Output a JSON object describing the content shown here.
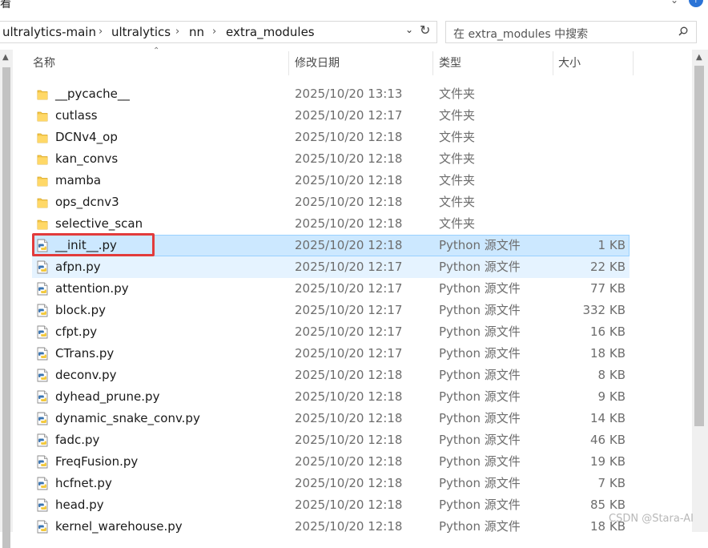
{
  "top": {
    "partial_char": "看"
  },
  "address": {
    "crumbs": [
      "ultralytics-main",
      "ultralytics",
      "nn",
      "extra_modules"
    ]
  },
  "search": {
    "placeholder": "在 extra_modules 中搜索"
  },
  "columns": {
    "name": "名称",
    "date": "修改日期",
    "type": "类型",
    "size": "大小"
  },
  "files": [
    {
      "name": "__pycache__",
      "date": "2025/10/20 13:13",
      "type": "文件夹",
      "size": "",
      "kind": "folder",
      "state": ""
    },
    {
      "name": "cutlass",
      "date": "2025/10/20 12:17",
      "type": "文件夹",
      "size": "",
      "kind": "folder",
      "state": ""
    },
    {
      "name": "DCNv4_op",
      "date": "2025/10/20 12:18",
      "type": "文件夹",
      "size": "",
      "kind": "folder",
      "state": ""
    },
    {
      "name": "kan_convs",
      "date": "2025/10/20 12:18",
      "type": "文件夹",
      "size": "",
      "kind": "folder",
      "state": ""
    },
    {
      "name": "mamba",
      "date": "2025/10/20 12:18",
      "type": "文件夹",
      "size": "",
      "kind": "folder",
      "state": ""
    },
    {
      "name": "ops_dcnv3",
      "date": "2025/10/20 12:18",
      "type": "文件夹",
      "size": "",
      "kind": "folder",
      "state": ""
    },
    {
      "name": "selective_scan",
      "date": "2025/10/20 12:18",
      "type": "文件夹",
      "size": "",
      "kind": "folder",
      "state": ""
    },
    {
      "name": "__init__.py",
      "date": "2025/10/20 12:18",
      "type": "Python 源文件",
      "size": "1 KB",
      "kind": "python",
      "state": "selected"
    },
    {
      "name": "afpn.py",
      "date": "2025/10/20 12:17",
      "type": "Python 源文件",
      "size": "22 KB",
      "kind": "python",
      "state": "hover"
    },
    {
      "name": "attention.py",
      "date": "2025/10/20 12:17",
      "type": "Python 源文件",
      "size": "77 KB",
      "kind": "python",
      "state": ""
    },
    {
      "name": "block.py",
      "date": "2025/10/20 12:17",
      "type": "Python 源文件",
      "size": "332 KB",
      "kind": "python",
      "state": ""
    },
    {
      "name": "cfpt.py",
      "date": "2025/10/20 12:17",
      "type": "Python 源文件",
      "size": "16 KB",
      "kind": "python",
      "state": ""
    },
    {
      "name": "CTrans.py",
      "date": "2025/10/20 12:17",
      "type": "Python 源文件",
      "size": "18 KB",
      "kind": "python",
      "state": ""
    },
    {
      "name": "deconv.py",
      "date": "2025/10/20 12:18",
      "type": "Python 源文件",
      "size": "8 KB",
      "kind": "python",
      "state": ""
    },
    {
      "name": "dyhead_prune.py",
      "date": "2025/10/20 12:18",
      "type": "Python 源文件",
      "size": "9 KB",
      "kind": "python",
      "state": ""
    },
    {
      "name": "dynamic_snake_conv.py",
      "date": "2025/10/20 12:18",
      "type": "Python 源文件",
      "size": "14 KB",
      "kind": "python",
      "state": ""
    },
    {
      "name": "fadc.py",
      "date": "2025/10/20 12:18",
      "type": "Python 源文件",
      "size": "46 KB",
      "kind": "python",
      "state": ""
    },
    {
      "name": "FreqFusion.py",
      "date": "2025/10/20 12:18",
      "type": "Python 源文件",
      "size": "19 KB",
      "kind": "python",
      "state": ""
    },
    {
      "name": "hcfnet.py",
      "date": "2025/10/20 12:18",
      "type": "Python 源文件",
      "size": "7 KB",
      "kind": "python",
      "state": ""
    },
    {
      "name": "head.py",
      "date": "2025/10/20 12:18",
      "type": "Python 源文件",
      "size": "85 KB",
      "kind": "python",
      "state": ""
    },
    {
      "name": "kernel_warehouse.py",
      "date": "2025/10/20 12:18",
      "type": "Python 源文件",
      "size": "18 KB",
      "kind": "python",
      "state": ""
    }
  ],
  "watermark": "CSDN @Stara-AI",
  "colors": {
    "selected_bg": "#cce8ff",
    "hover_bg": "#e5f3ff",
    "highlight_box": "#e23b3b",
    "folder": "#f4c84a"
  }
}
